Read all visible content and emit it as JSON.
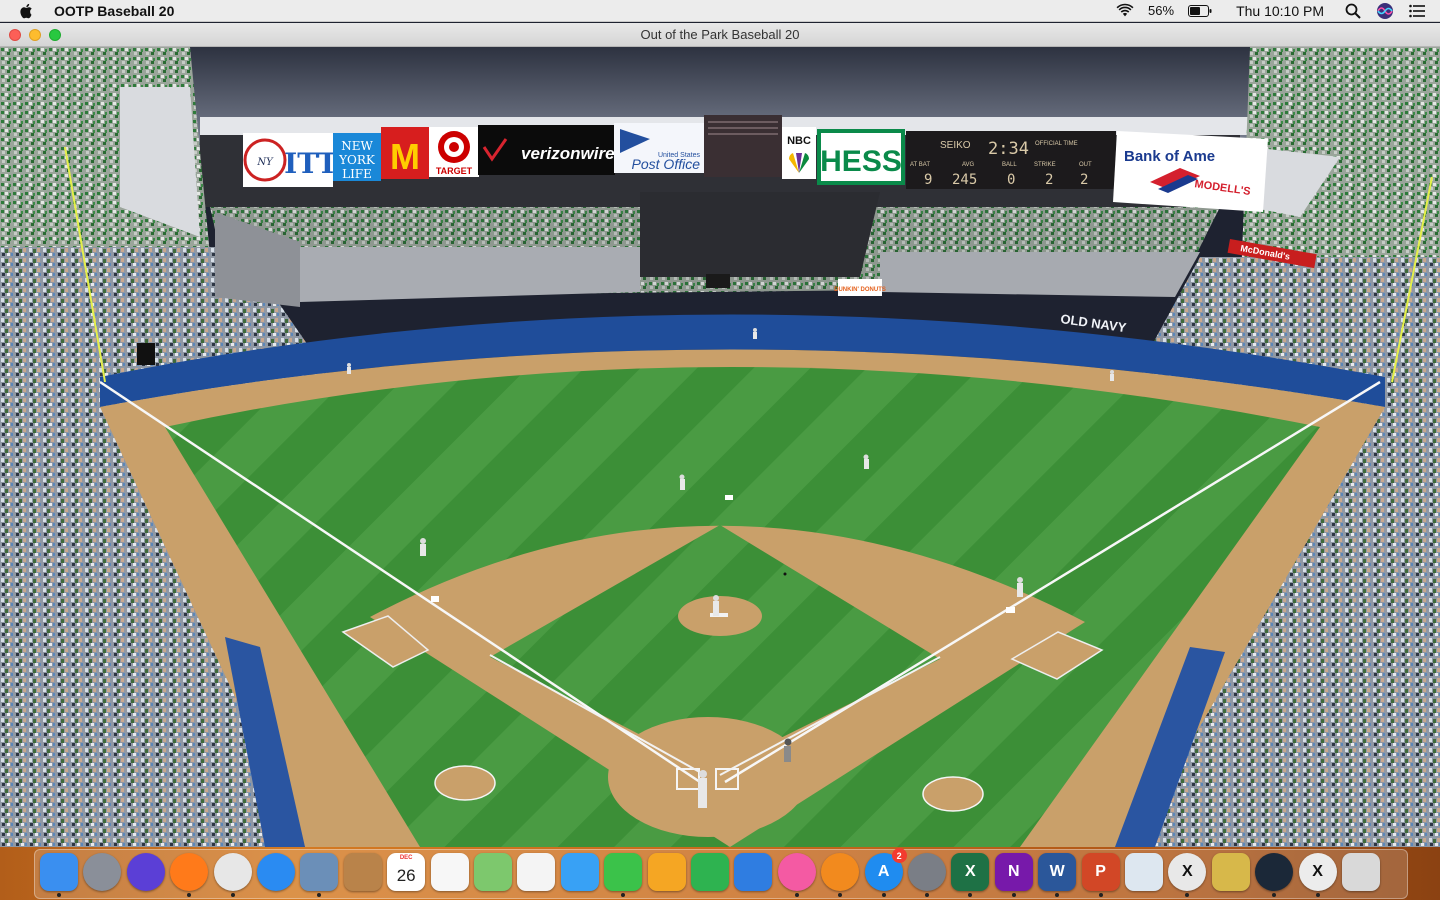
{
  "menubar": {
    "app_name": "OOTP Baseball 20",
    "battery": "56%",
    "clock": "Thu 10:10 PM"
  },
  "window": {
    "title": "Out of the Park Baseball 20"
  },
  "stadium": {
    "billboards": {
      "itt": "ITT",
      "nylife_line1": "NEW",
      "nylife_line2": "YORK",
      "nylife_line3": "LIFE",
      "mcdonalds": "M",
      "target": "TARGET",
      "verizon": "verizonwirel",
      "postoffice_small": "United States",
      "postoffice": "Post Office",
      "nbc": "NBC",
      "hess": "HESS",
      "bankofamerica": "Bank of Ame",
      "modells": "MODELL'S",
      "oldnavy": "OLD NAVY",
      "dunkin": "DUNKIN' DONUTS",
      "mcdonalds_right": "McDonald's"
    },
    "scoreboard": {
      "brand": "SEIKO",
      "time": "2:34",
      "official_label": "OFFICIAL TIME",
      "at_bat_label": "AT BAT",
      "at_bat": "9",
      "avg_label": "AVG",
      "avg": "245",
      "ball_label": "BALL",
      "ball": "0",
      "strike_label": "STRIKE",
      "strike": "2",
      "out_label": "OUT",
      "out": "2"
    }
  },
  "dock": {
    "calendar_month": "DEC",
    "calendar_day": "26",
    "appstore_badge": "2",
    "items": [
      {
        "name": "finder",
        "color": "#3a8ff0",
        "glyph": ""
      },
      {
        "name": "launchpad",
        "color": "#8a8f99",
        "glyph": ""
      },
      {
        "name": "siri",
        "color": "#5b3fd6",
        "glyph": ""
      },
      {
        "name": "firefox",
        "color": "#ff7a1a",
        "glyph": ""
      },
      {
        "name": "chrome",
        "color": "#e7e7e7",
        "glyph": ""
      },
      {
        "name": "safari",
        "color": "#2a8bf2",
        "glyph": ""
      },
      {
        "name": "preview",
        "color": "#6b8fb8",
        "glyph": ""
      },
      {
        "name": "contacts",
        "color": "#b9834a",
        "glyph": ""
      },
      {
        "name": "calendar",
        "color": "#ffffff",
        "glyph": ""
      },
      {
        "name": "reminders",
        "color": "#f7f7f7",
        "glyph": ""
      },
      {
        "name": "maps",
        "color": "#7dc86d",
        "glyph": ""
      },
      {
        "name": "photos",
        "color": "#f4f4f4",
        "glyph": ""
      },
      {
        "name": "messages",
        "color": "#38a1f5",
        "glyph": ""
      },
      {
        "name": "facetime",
        "color": "#3bc24a",
        "glyph": ""
      },
      {
        "name": "pages",
        "color": "#f5a623",
        "glyph": ""
      },
      {
        "name": "numbers",
        "color": "#2eb350",
        "glyph": ""
      },
      {
        "name": "keynote",
        "color": "#2f7de1",
        "glyph": ""
      },
      {
        "name": "itunes",
        "color": "#f45aa3",
        "glyph": ""
      },
      {
        "name": "books",
        "color": "#f28a1e",
        "glyph": ""
      },
      {
        "name": "appstore",
        "color": "#1f8cf0",
        "glyph": "A"
      },
      {
        "name": "system-preferences",
        "color": "#7a7e86",
        "glyph": ""
      },
      {
        "name": "excel",
        "color": "#1e7145",
        "glyph": "X"
      },
      {
        "name": "onenote",
        "color": "#7719aa",
        "glyph": "N"
      },
      {
        "name": "word",
        "color": "#2b579a",
        "glyph": "W"
      },
      {
        "name": "powerpoint",
        "color": "#d24726",
        "glyph": "P"
      },
      {
        "name": "xcode-installer",
        "color": "#dde7f0",
        "glyph": ""
      },
      {
        "name": "ootp-x",
        "color": "#e8e8e8",
        "glyph": "X"
      },
      {
        "name": "archive-utility",
        "color": "#d7b84a",
        "glyph": ""
      },
      {
        "name": "steam",
        "color": "#1b2838",
        "glyph": ""
      },
      {
        "name": "ootp-20",
        "color": "#ececec",
        "glyph": "X"
      },
      {
        "name": "trash",
        "color": "#d9d9d9",
        "glyph": ""
      }
    ]
  }
}
